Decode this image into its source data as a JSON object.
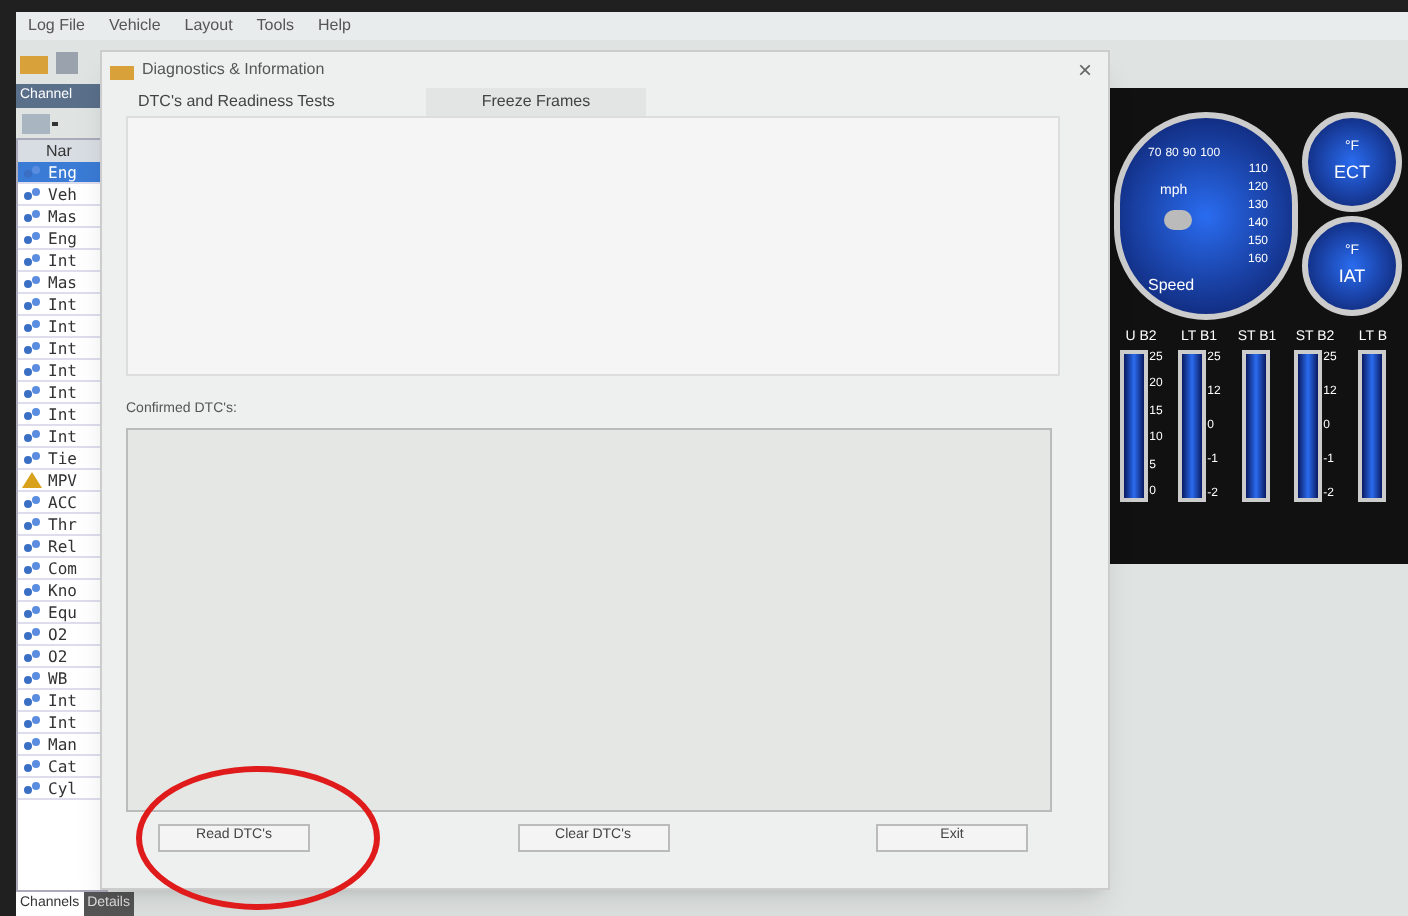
{
  "menu": [
    "Log File",
    "Vehicle",
    "Layout",
    "Tools",
    "Help"
  ],
  "channels_panel": {
    "title": "Channel",
    "header": "Nar",
    "rows": [
      {
        "text": "Eng",
        "selected": true,
        "kind": "channel"
      },
      {
        "text": "Veh",
        "selected": false,
        "kind": "channel"
      },
      {
        "text": "Mas",
        "selected": false,
        "kind": "channel"
      },
      {
        "text": "Eng",
        "selected": false,
        "kind": "channel"
      },
      {
        "text": "Int",
        "selected": false,
        "kind": "channel"
      },
      {
        "text": "Mas",
        "selected": false,
        "kind": "channel"
      },
      {
        "text": "Int",
        "selected": false,
        "kind": "channel"
      },
      {
        "text": "Int",
        "selected": false,
        "kind": "channel"
      },
      {
        "text": "Int",
        "selected": false,
        "kind": "channel"
      },
      {
        "text": "Int",
        "selected": false,
        "kind": "channel"
      },
      {
        "text": "Int",
        "selected": false,
        "kind": "channel"
      },
      {
        "text": "Int",
        "selected": false,
        "kind": "channel"
      },
      {
        "text": "Int",
        "selected": false,
        "kind": "channel"
      },
      {
        "text": "Tie",
        "selected": false,
        "kind": "channel"
      },
      {
        "text": "MPV",
        "selected": false,
        "kind": "warning"
      },
      {
        "text": "ACC",
        "selected": false,
        "kind": "channel"
      },
      {
        "text": "Thr",
        "selected": false,
        "kind": "channel"
      },
      {
        "text": "Rel",
        "selected": false,
        "kind": "channel"
      },
      {
        "text": "Com",
        "selected": false,
        "kind": "channel"
      },
      {
        "text": "Kno",
        "selected": false,
        "kind": "channel"
      },
      {
        "text": "Equ",
        "selected": false,
        "kind": "channel"
      },
      {
        "text": "O2",
        "selected": false,
        "kind": "channel"
      },
      {
        "text": "O2",
        "selected": false,
        "kind": "channel"
      },
      {
        "text": "WB",
        "selected": false,
        "kind": "channel"
      },
      {
        "text": "Int",
        "selected": false,
        "kind": "channel"
      },
      {
        "text": "Int",
        "selected": false,
        "kind": "channel"
      },
      {
        "text": "Man",
        "selected": false,
        "kind": "channel"
      },
      {
        "text": "Cat",
        "selected": false,
        "kind": "channel"
      },
      {
        "text": "Cyl",
        "selected": false,
        "kind": "channel"
      }
    ],
    "tabs": [
      {
        "label": "Channels",
        "selected": true
      },
      {
        "label": "Details",
        "selected": false
      }
    ]
  },
  "dialog": {
    "title": "Diagnostics & Information",
    "close": "×",
    "tabs": [
      {
        "label": "DTC's and Readiness Tests",
        "selected": true
      },
      {
        "label": "Freeze Frames",
        "selected": false
      }
    ],
    "confirmed_label": "Confirmed DTC's:",
    "buttons": [
      "Read DTC's",
      "Clear DTC's",
      "Exit"
    ]
  },
  "gauges": {
    "speed": {
      "ticks": [
        "70",
        "80",
        "90",
        "100",
        "110",
        "120",
        "130",
        "140",
        "150",
        "160"
      ],
      "unit": "mph",
      "label": "Speed"
    },
    "small": [
      {
        "unit": "°F",
        "label": "ECT"
      },
      {
        "unit": "°F",
        "label": "IAT"
      }
    ],
    "bars": [
      {
        "label": "U B2",
        "ticks": [
          "25",
          "20",
          "15",
          "10",
          "5",
          "0"
        ]
      },
      {
        "label": "LT B1",
        "ticks": [
          "25",
          "12",
          "0",
          "-1",
          "-2"
        ]
      },
      {
        "label": "ST B1"
      },
      {
        "label": "ST B2",
        "ticks": [
          "25",
          "12",
          "0",
          "-1",
          "-2"
        ]
      },
      {
        "label": "LT B"
      }
    ]
  }
}
